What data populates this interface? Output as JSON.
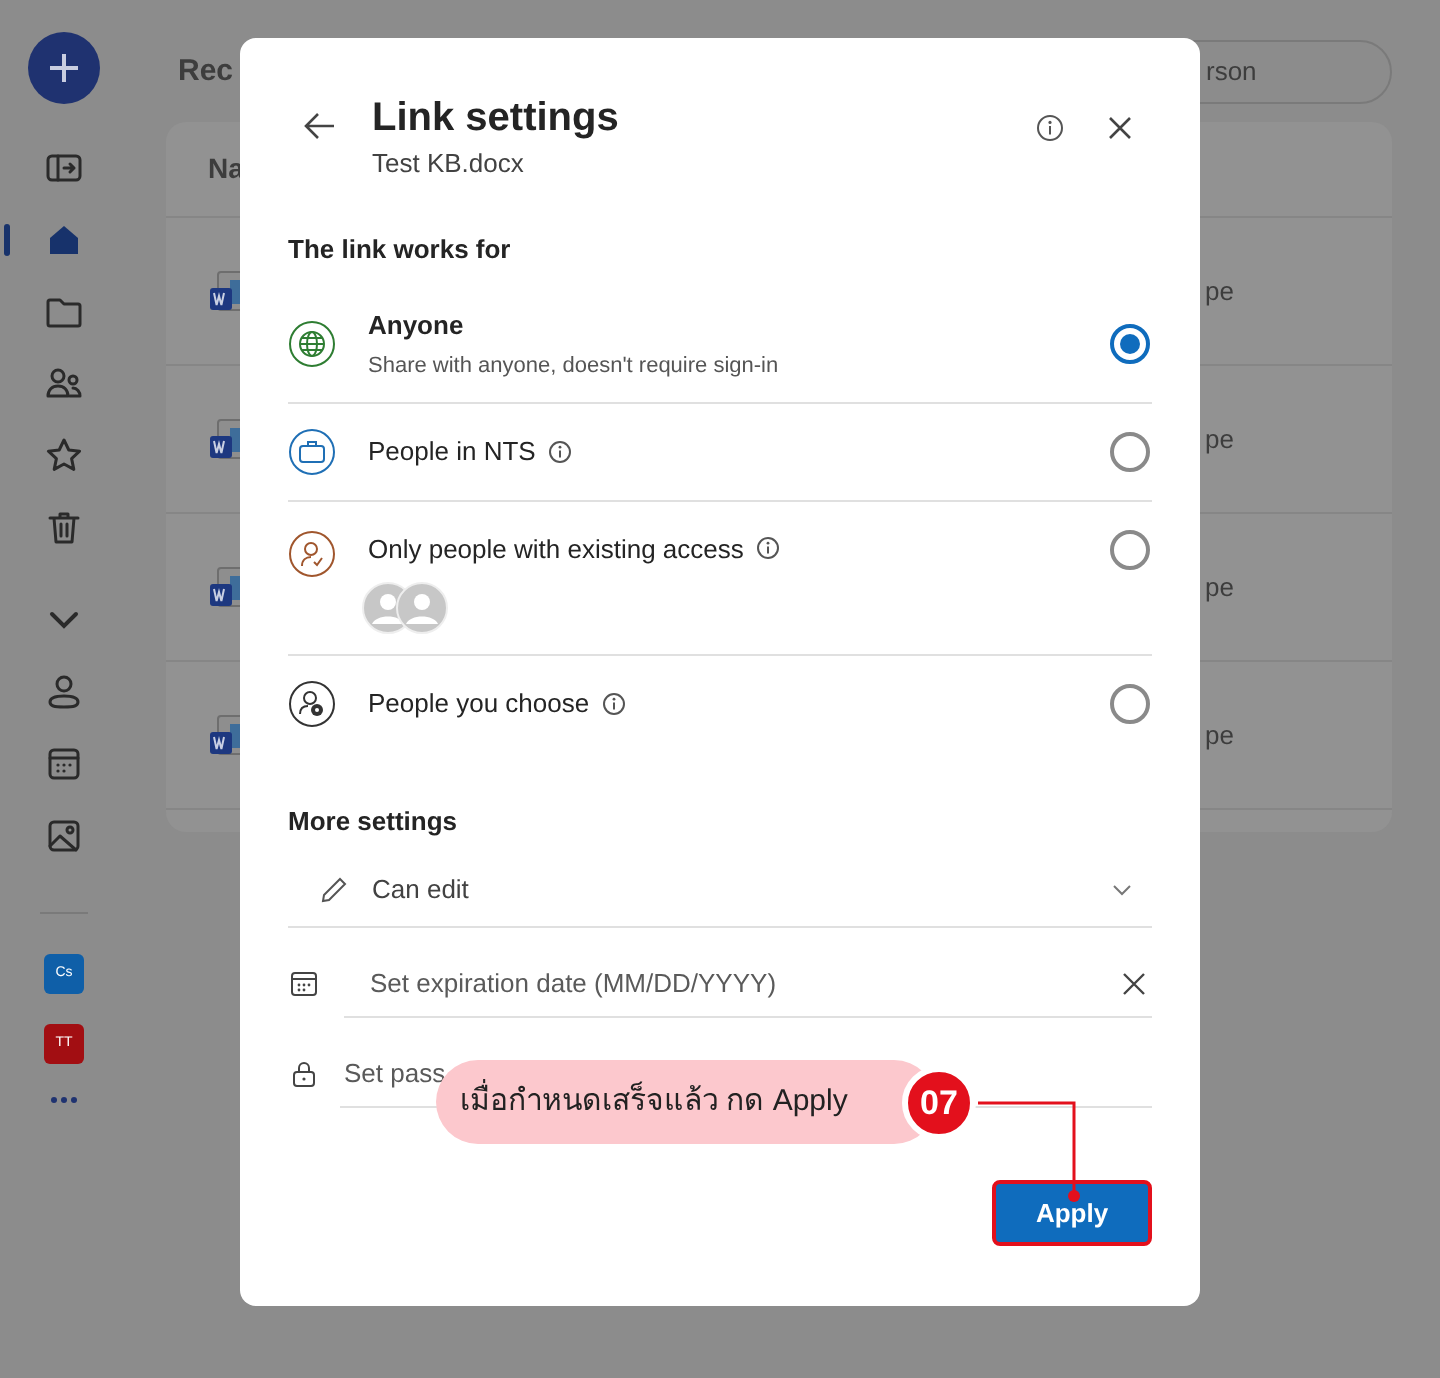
{
  "sidebar": {
    "items": [
      {
        "kind": "panel",
        "selected": false
      },
      {
        "kind": "home",
        "selected": true
      },
      {
        "kind": "folder",
        "selected": false
      },
      {
        "kind": "people",
        "selected": false
      },
      {
        "kind": "star",
        "selected": false
      },
      {
        "kind": "trash",
        "selected": false
      },
      {
        "kind": "chevron",
        "selected": false
      },
      {
        "kind": "person",
        "selected": false
      },
      {
        "kind": "calendar",
        "selected": false
      },
      {
        "kind": "image",
        "selected": false
      }
    ],
    "apps": [
      {
        "label": "Cs",
        "color": "#0f5fa8"
      },
      {
        "label": "TT",
        "color": "#a20e12"
      }
    ]
  },
  "main": {
    "heading": "Rec",
    "search": {
      "placeholder": "rson"
    },
    "column_1": "Na",
    "rows": [
      {
        "column_2": "pe"
      },
      {
        "column_2": "pe"
      },
      {
        "column_2": "pe"
      },
      {
        "column_2": "pe"
      }
    ]
  },
  "dialog": {
    "title": "Link settings",
    "subtitle": "Test KB.docx",
    "section": "The link works for",
    "options": [
      {
        "kind": "globe",
        "label": "Anyone",
        "description": "Share with anyone, doesn't require sign-in",
        "info": false,
        "selected": true
      },
      {
        "kind": "briefcase",
        "label": "People in NTS",
        "info": true,
        "selected": false
      },
      {
        "kind": "existing",
        "label": "Only people with existing access",
        "info": true,
        "avatars": true,
        "selected": false
      },
      {
        "kind": "choose",
        "label": "People you choose",
        "info": true,
        "selected": false
      }
    ],
    "more_settings": "More settings",
    "permission": "Can edit",
    "expiration": {
      "placeholder": "Set expiration date (MM/DD/YYYY)"
    },
    "password": {
      "placeholder": "Set pass"
    },
    "apply": "Apply"
  },
  "callout": {
    "text": "เมื่อกำหนดเสร็จแล้ว กด Apply",
    "step": "07"
  }
}
